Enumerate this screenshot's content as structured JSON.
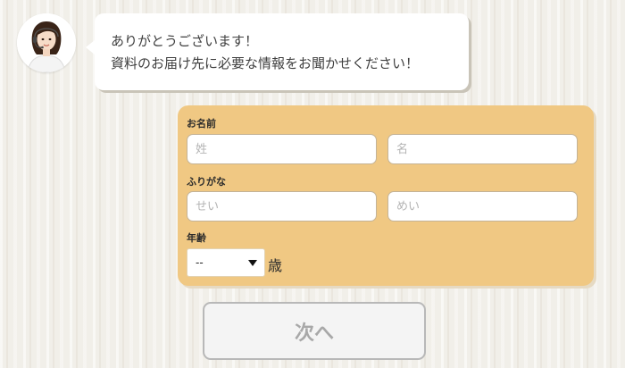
{
  "chat": {
    "message_line1": "ありがとうございます！",
    "message_line2": "資料のお届け先に必要な情報をお聞かせください！"
  },
  "form": {
    "name": {
      "label": "お名前",
      "last_placeholder": "姓",
      "first_placeholder": "名"
    },
    "furigana": {
      "label": "ふりがな",
      "last_placeholder": "せい",
      "first_placeholder": "めい"
    },
    "age": {
      "label": "年齢",
      "selected": "--",
      "unit": "歳"
    }
  },
  "next_button": {
    "label": "次へ"
  },
  "colors": {
    "form_bg": "#f0c883",
    "bubble_bg": "#ffffff",
    "button_text": "#a8a8a8"
  }
}
